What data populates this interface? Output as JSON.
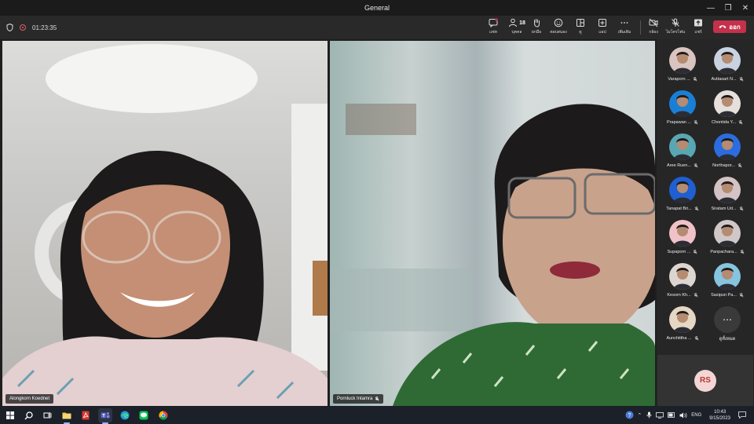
{
  "window": {
    "title": "General"
  },
  "meeting": {
    "timer": "01:23:35"
  },
  "toolbar": {
    "chat_label": "แชท",
    "people_label": "บุคคล",
    "people_count": "18",
    "raise_label": "ยกมือ",
    "react_label": "ตอบสนอง",
    "rooms_label": "ดู",
    "apps_label": "แอป",
    "more_label": "เพิ่มเติม",
    "camera_label": "กล้อง",
    "mic_label": "ไมโครโฟน",
    "share_label": "แชร์",
    "leave_label": "ออก"
  },
  "tiles": [
    {
      "name": "Alongkorn Koednet"
    },
    {
      "name": "Pornluck Intamra"
    }
  ],
  "participants": [
    {
      "name": "Varaporn ...",
      "color": "#d9c4c0"
    },
    {
      "name": "Auttasart N...",
      "color": "#c9d2e0"
    },
    {
      "name": "Prapawan ...",
      "color": "#1a7fd4"
    },
    {
      "name": "Chontida Y...",
      "color": "#e5e0dc"
    },
    {
      "name": "Aree Ruen...",
      "color": "#58a7b3"
    },
    {
      "name": "Northapor...",
      "color": "#2b6de0"
    },
    {
      "name": "Tanapat Bri...",
      "color": "#1f5fd1"
    },
    {
      "name": "Siratam Ud...",
      "color": "#d3c3c5"
    },
    {
      "name": "Supaporn ...",
      "color": "#f0c2c8"
    },
    {
      "name": "Panpachara...",
      "color": "#d0c8c8"
    },
    {
      "name": "Kesorn Kh...",
      "color": "#ddd5cf"
    },
    {
      "name": "Sasipun Pa...",
      "color": "#86c4e0"
    },
    {
      "name": "Aunchittha ...",
      "color": "#e4d7c4"
    }
  ],
  "view_all": {
    "label": "ดูทั้งหมด"
  },
  "self": {
    "initials": "RS"
  },
  "taskbar": {
    "lang": "ENG",
    "time": "10:43",
    "date": "9/15/2023"
  }
}
